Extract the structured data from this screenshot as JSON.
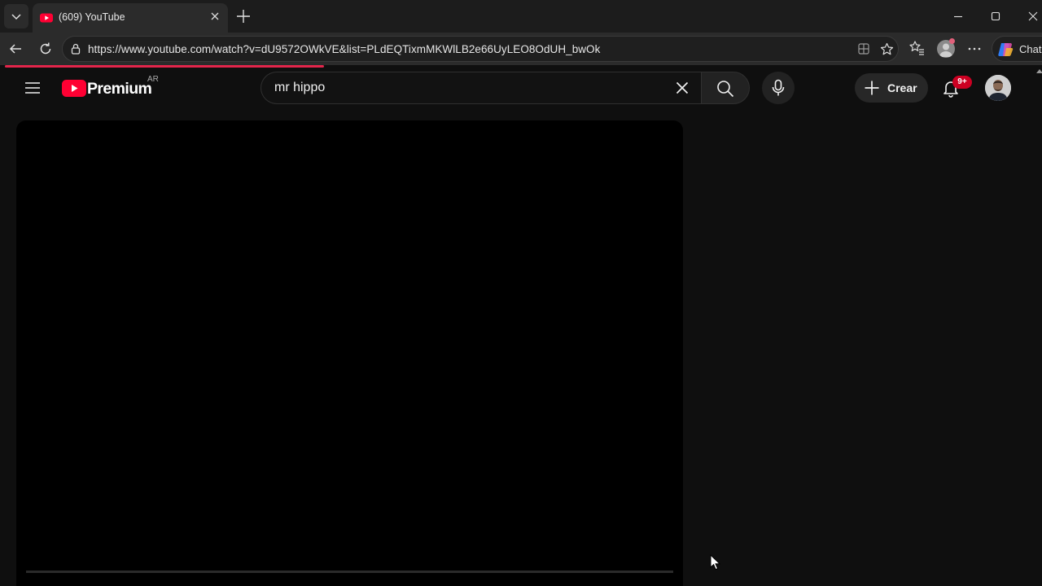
{
  "browser": {
    "tab": {
      "title": "(609) YouTube",
      "favicon": "youtube-favicon-icon"
    },
    "address": {
      "url": "https://www.youtube.com/watch?v=dU9572OWkVE&list=PLdEQTixmMKWlLB2e66UyLEO8OdUH_bwOk"
    },
    "chat_label": "Chat"
  },
  "youtube": {
    "logo_text": "Premium",
    "region": "AR",
    "search": {
      "value": "mr hippo"
    },
    "create_label": "Crear",
    "notification_count": "9+"
  },
  "colors": {
    "accent": "#ff0033",
    "badge": "#cc0022",
    "page_bg": "#0f0f0f",
    "loading_bar": "#e3254b"
  },
  "icons": [
    "tab-list-icon",
    "youtube-favicon-icon",
    "close-tab-icon",
    "new-tab-icon",
    "minimize-icon",
    "maximize-icon",
    "close-window-icon",
    "back-icon",
    "refresh-icon",
    "site-info-icon",
    "app-available-icon",
    "favorite-star-icon",
    "favorites-icon",
    "profile-icon",
    "more-icon",
    "copilot-icon",
    "hamburger-menu-icon",
    "youtube-logo-icon",
    "clear-search-icon",
    "search-icon",
    "mic-icon",
    "plus-icon",
    "bell-icon",
    "avatar",
    "mouse-cursor-icon"
  ]
}
